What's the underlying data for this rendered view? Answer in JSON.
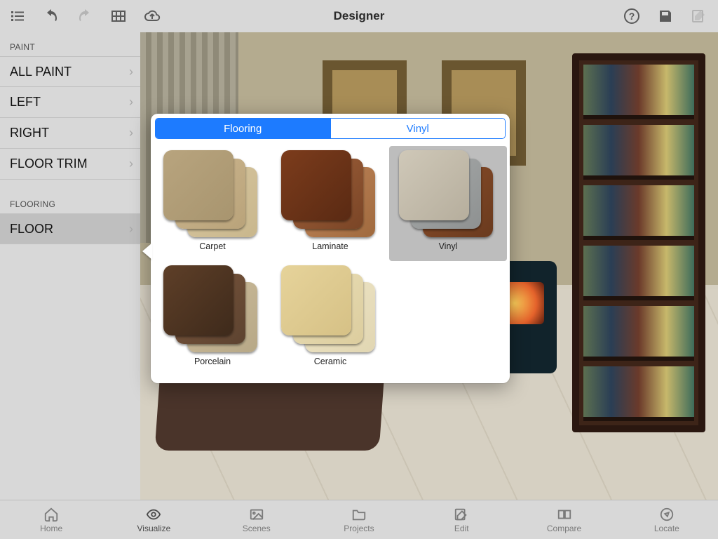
{
  "header": {
    "title": "Designer"
  },
  "sidebar": {
    "sections": [
      {
        "header": "PAINT",
        "items": [
          {
            "label": "ALL PAINT"
          },
          {
            "label": "LEFT"
          },
          {
            "label": "RIGHT"
          },
          {
            "label": "FLOOR TRIM"
          }
        ]
      },
      {
        "header": "FLOORING",
        "items": [
          {
            "label": "FLOOR"
          }
        ]
      }
    ]
  },
  "popup": {
    "tabs": [
      {
        "label": "Flooring",
        "active": true
      },
      {
        "label": "Vinyl",
        "active": false
      }
    ],
    "items": [
      {
        "label": "Carpet",
        "key": "carpet",
        "selected": false
      },
      {
        "label": "Laminate",
        "key": "laminate",
        "selected": false
      },
      {
        "label": "Vinyl",
        "key": "vinyl",
        "selected": true
      },
      {
        "label": "Porcelain",
        "key": "porcelain",
        "selected": false
      },
      {
        "label": "Ceramic",
        "key": "ceramic",
        "selected": false
      }
    ]
  },
  "tabbar": {
    "items": [
      {
        "label": "Home"
      },
      {
        "label": "Visualize"
      },
      {
        "label": "Scenes"
      },
      {
        "label": "Projects"
      },
      {
        "label": "Edit"
      },
      {
        "label": "Compare"
      },
      {
        "label": "Locate"
      }
    ],
    "active_index": 1
  }
}
